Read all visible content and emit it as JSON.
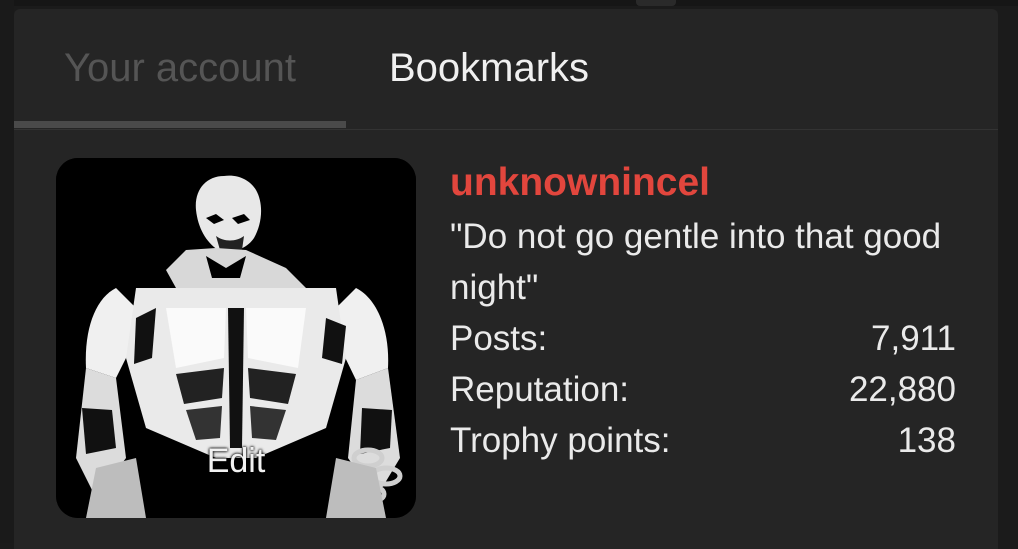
{
  "tabs": [
    {
      "label": "Your account",
      "active": false
    },
    {
      "label": "Bookmarks",
      "active": true
    }
  ],
  "avatar": {
    "icon": "user-avatar-image",
    "edit_label": "Edit"
  },
  "user": {
    "username": "unknownincel",
    "username_color": "#e2463d",
    "custom_title": "\"Do not go gentle into that good night\""
  },
  "stats": [
    {
      "label": "Posts:",
      "value": "7,911"
    },
    {
      "label": "Reputation:",
      "value": "22,880"
    },
    {
      "label": "Trophy points:",
      "value": "138"
    }
  ]
}
